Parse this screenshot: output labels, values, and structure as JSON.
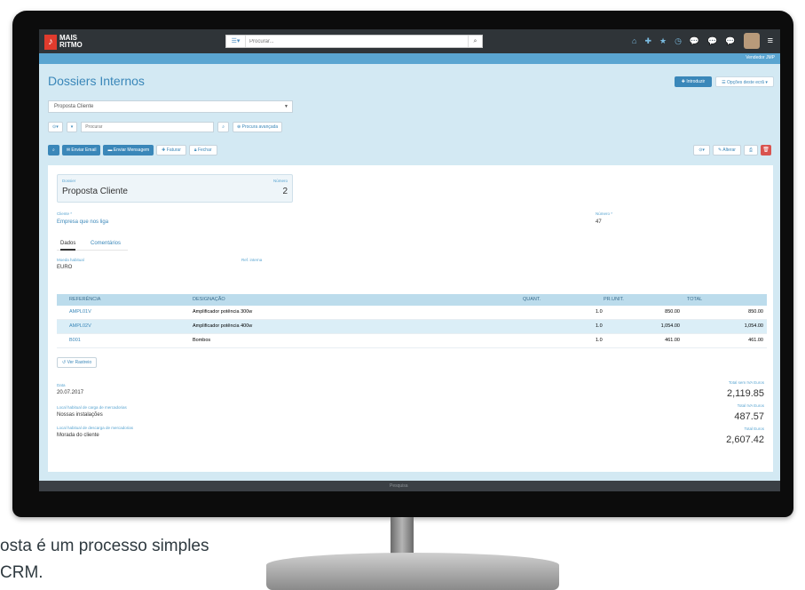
{
  "app": {
    "logo_line1": "MAIS",
    "logo_line2": "RITMO",
    "search_placeholder": "Procurar...",
    "user": "Vendedor JMP"
  },
  "header": {
    "title": "Dossiers Internos",
    "introduzir_label": "Introduzir",
    "opcoes_label": "Opções deste ecrã"
  },
  "filter": {
    "document_type": "Proposta Cliente",
    "search_placeholder": "Procurar",
    "advanced_search_label": "Procura avançada"
  },
  "actions": {
    "enviar_email": "Enviar Email",
    "enviar_mensagem": "Enviar Mensagem",
    "faturar": "Faturar",
    "fechar": "Fechar",
    "alterar": "Alterar"
  },
  "document": {
    "dossier_label": "Dossier",
    "dossier_value": "Proposta Cliente",
    "numero_label": "Número",
    "numero_value": "2",
    "cliente_label": "Cliente *",
    "cliente_value": "Empresa que nos liga",
    "numero_cliente_label": "Número *",
    "numero_cliente_value": "47"
  },
  "tabs": [
    "Dados",
    "Comentários"
  ],
  "dados": {
    "moeda_label": "Moeda habitual",
    "moeda_value": "EURO",
    "ref_interna_label": "Ref. interna"
  },
  "table": {
    "headers": [
      "REFERÊNCIA",
      "DESIGNAÇÃO",
      "QUANT.",
      "PR.UNIT.",
      "TOTAL"
    ],
    "rows": [
      {
        "ref": "AMPL01V",
        "designacao": "Amplificador potência 300w",
        "quant": "1.0",
        "prunit": "850.00",
        "total": "850.00"
      },
      {
        "ref": "AMPL02V",
        "designacao": "Amplificador potência 400w",
        "quant": "1.0",
        "prunit": "1,054.00",
        "total": "1,054.00"
      },
      {
        "ref": "B001",
        "designacao": "Bombos",
        "quant": "1.0",
        "prunit": "461.00",
        "total": "461.00"
      }
    ]
  },
  "ver_rastreio": "Ver Rastreio",
  "footer_fields": {
    "data_label": "Data",
    "data_value": "20.07.2017",
    "carga_label": "Local habitual de carga de mercadorias",
    "carga_value": "Nossas instalações",
    "descarga_label": "Local habitual de descarga de mercadorias",
    "descarga_value": "Morada do cliente"
  },
  "totals": {
    "sem_iva_label": "Total sem IVA Euros",
    "sem_iva_value": "2,119.85",
    "iva_label": "Total IVA Euros",
    "iva_value": "487.57",
    "total_label": "Total Euros",
    "total_value": "2,607.42"
  },
  "bottom_bar_text": "Pesquisa",
  "caption": {
    "line1": "osta é um processo simples",
    "line2": "CRM."
  },
  "colors": {
    "accent": "#3a87b9",
    "logo_red": "#e03b2d",
    "delete_red": "#d9534f",
    "screen_bg": "#d3e9f3"
  }
}
